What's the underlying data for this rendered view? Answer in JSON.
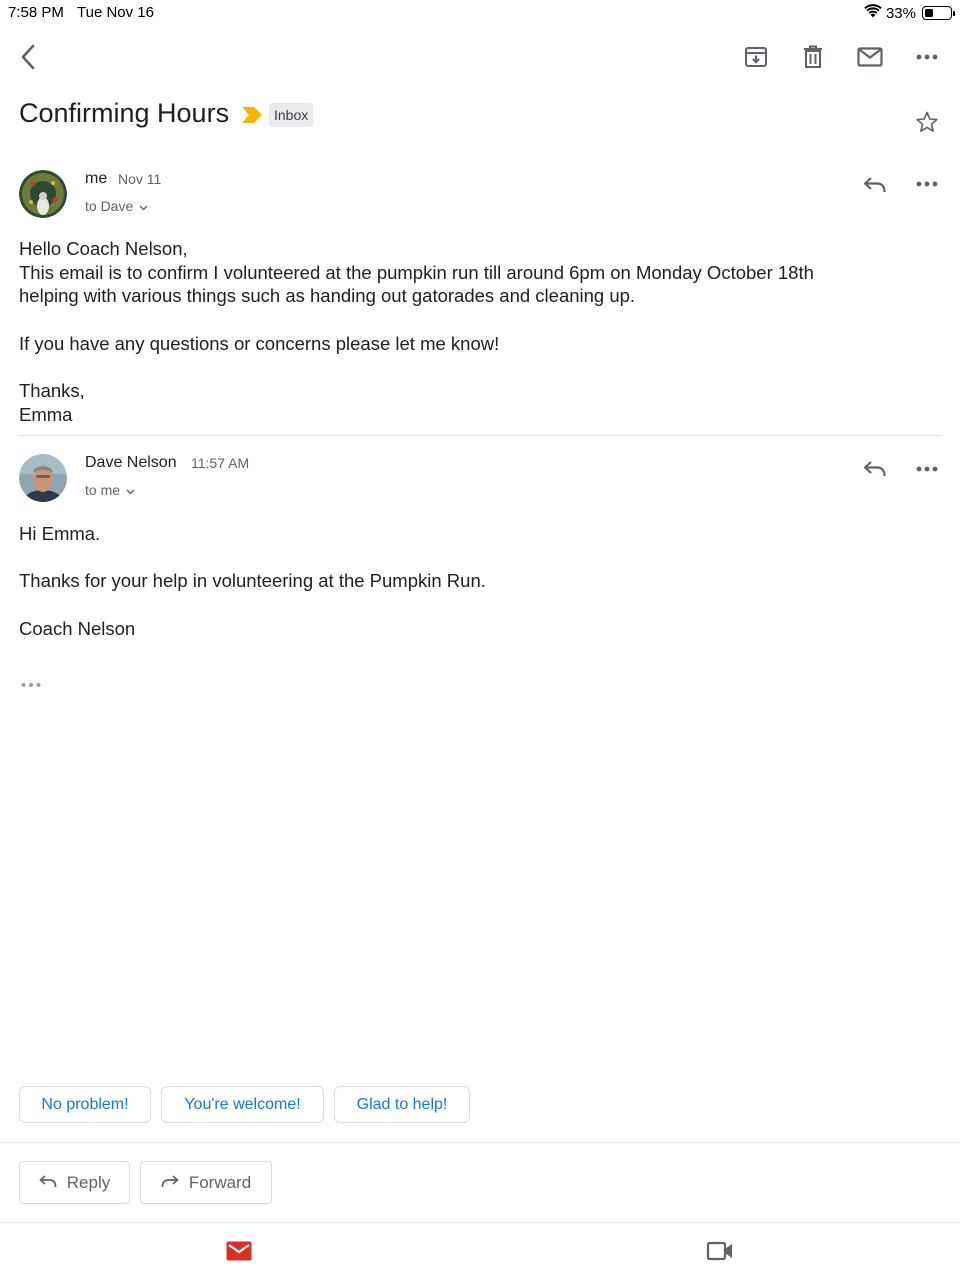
{
  "status_bar": {
    "time": "7:58 PM",
    "date": "Tue Nov 16",
    "battery": "33%",
    "battery_level": 0.33
  },
  "toolbar": {
    "icons": [
      "back-arrow-icon",
      "archive-icon",
      "delete-icon",
      "mark-unread-icon",
      "more-options-icon"
    ]
  },
  "thread": {
    "subject": "Confirming Hours",
    "label": "Inbox",
    "importance_color": "#f4b400"
  },
  "messages": [
    {
      "sender": "me",
      "date": "Nov 11",
      "recipient": "to Dave",
      "body": "Hello Coach Nelson,\nThis email is to confirm I volunteered at the pumpkin run till around 6pm on Monday October 18th\nhelping with various things such as handing out gatorades and cleaning up.\n\nIf you have any questions or concerns please let me know!\n\nThanks,\nEmma"
    },
    {
      "sender": "Dave Nelson",
      "date": "11:57 AM",
      "recipient": "to me",
      "body": "Hi Emma.\n\nThanks for your help in volunteering at the Pumpkin Run.\n\nCoach Nelson"
    }
  ],
  "smart_replies": [
    "No problem!",
    "You're welcome!",
    "Glad to help!"
  ],
  "actions": {
    "reply": "Reply",
    "forward": "Forward"
  },
  "bottom_nav": {
    "icons": [
      "mail-icon",
      "video-meet-icon"
    ],
    "mail_color": "#d93025"
  },
  "colors": {
    "accent": "#1a73e8",
    "text": "#202124",
    "secondary": "#5f6368"
  }
}
